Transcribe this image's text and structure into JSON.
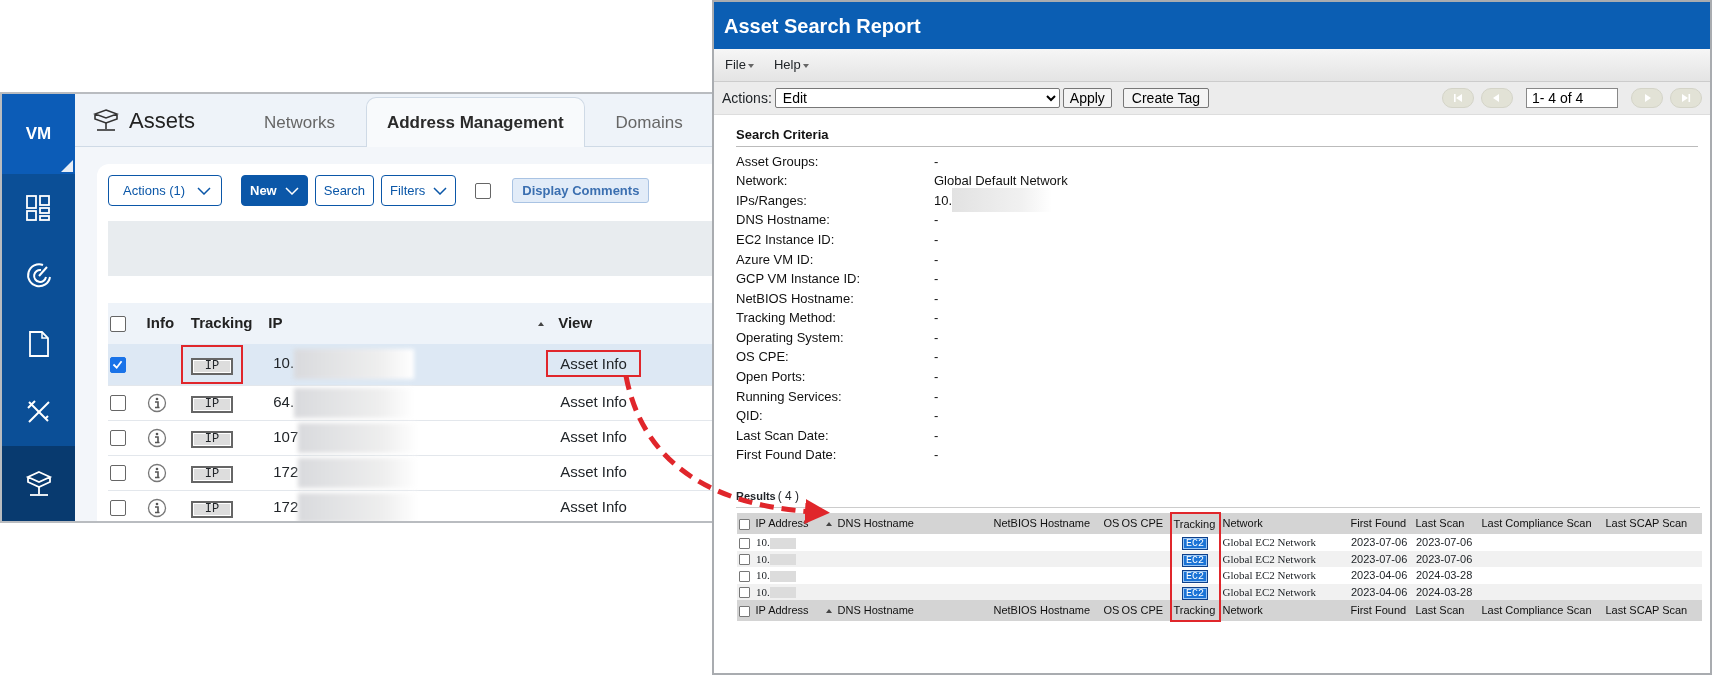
{
  "assets_app": {
    "logo": "VM",
    "sidebar": [
      {
        "kind": "dashboard",
        "selected": false
      },
      {
        "kind": "gauge",
        "selected": false
      },
      {
        "kind": "document",
        "selected": false
      },
      {
        "kind": "tools",
        "selected": false
      },
      {
        "kind": "assets",
        "selected": true
      }
    ],
    "title": "Assets",
    "tabs": [
      {
        "label": "Networks",
        "selected": false
      },
      {
        "label": "Address Management",
        "selected": true
      },
      {
        "label": "Domains",
        "selected": false
      }
    ],
    "toolbar": {
      "actions": "Actions (1)",
      "new": "New",
      "search": "Search",
      "filters": "Filters",
      "display_comments": {
        "label": "Display Comments",
        "checked": false
      }
    },
    "table": {
      "header_checked": false,
      "columns": [
        {
          "label": "Info",
          "sorted": false
        },
        {
          "label": "Tracking",
          "sorted": false
        },
        {
          "label": "IP",
          "sorted": false
        },
        {
          "label": "View",
          "sorted": true
        }
      ],
      "rows": [
        {
          "checked": true,
          "selected": true,
          "highlighted": true,
          "info_icon": false,
          "tracking": "IP",
          "ip": "10.",
          "view": "Asset Info"
        },
        {
          "checked": false,
          "selected": false,
          "highlighted": false,
          "info_icon": true,
          "tracking": "IP",
          "ip": "64.",
          "view": "Asset Info"
        },
        {
          "checked": false,
          "selected": false,
          "highlighted": false,
          "info_icon": true,
          "tracking": "IP",
          "ip": "107",
          "view": "Asset Info"
        },
        {
          "checked": false,
          "selected": false,
          "highlighted": false,
          "info_icon": true,
          "tracking": "IP",
          "ip": "172",
          "view": "Asset Info"
        },
        {
          "checked": false,
          "selected": false,
          "highlighted": false,
          "info_icon": true,
          "tracking": "IP",
          "ip": "172",
          "view": "Asset Info"
        }
      ]
    }
  },
  "report_window": {
    "title": "Asset Search Report",
    "menu": [
      "File",
      "Help"
    ],
    "actions": {
      "label": "Actions:",
      "select": "Edit",
      "apply": "Apply",
      "create_tag": "Create Tag",
      "pager": "1- 4 of 4"
    },
    "criteria": {
      "heading": "Search Criteria",
      "items": [
        {
          "label": "Asset Groups:",
          "value": "-"
        },
        {
          "label": "Network:",
          "value": "Global Default Network"
        },
        {
          "label": "IPs/Ranges:",
          "value": "10.",
          "blurred": true
        },
        {
          "label": "DNS Hostname:",
          "value": "-"
        },
        {
          "label": "EC2 Instance ID:",
          "value": "-"
        },
        {
          "label": "Azure VM ID:",
          "value": "-"
        },
        {
          "label": "GCP VM Instance ID:",
          "value": "-"
        },
        {
          "label": "NetBIOS Hostname:",
          "value": "-"
        },
        {
          "label": "Tracking Method:",
          "value": "-"
        },
        {
          "label": "Operating System:",
          "value": "-"
        },
        {
          "label": "OS CPE:",
          "value": "-"
        },
        {
          "label": "Open Ports:",
          "value": "-"
        },
        {
          "label": "Running Services:",
          "value": "-"
        },
        {
          "label": "QID:",
          "value": "-"
        },
        {
          "label": "Last Scan Date:",
          "value": "-"
        },
        {
          "label": "First Found Date:",
          "value": "-"
        }
      ]
    },
    "results": {
      "label": "Results",
      "count": "( 4 )",
      "header_checked": false,
      "footer_checked": false,
      "columns": [
        {
          "label": "IP Address",
          "sorted": false,
          "highlighted": false
        },
        {
          "label": "DNS Hostname",
          "sorted": true,
          "highlighted": false
        },
        {
          "label": "NetBIOS Hostname",
          "sorted": false,
          "highlighted": false
        },
        {
          "label": "OS",
          "sorted": false,
          "highlighted": false
        },
        {
          "label": "OS CPE",
          "sorted": false,
          "highlighted": false
        },
        {
          "label": "Tracking",
          "sorted": false,
          "highlighted": true
        },
        {
          "label": "Network",
          "sorted": false,
          "highlighted": false
        },
        {
          "label": "First Found",
          "sorted": false,
          "highlighted": false
        },
        {
          "label": "Last Scan",
          "sorted": false,
          "highlighted": false
        },
        {
          "label": "Last Compliance Scan",
          "sorted": false,
          "highlighted": false
        },
        {
          "label": "Last SCAP Scan",
          "sorted": false,
          "highlighted": false
        }
      ],
      "rows": [
        {
          "checked": false,
          "ip": "10.",
          "tracking": "EC2",
          "network": "Global EC2 Network",
          "first_found": "2023-07-06",
          "last_scan": "2023-07-06"
        },
        {
          "checked": false,
          "ip": "10.",
          "tracking": "EC2",
          "network": "Global EC2 Network",
          "first_found": "2023-07-06",
          "last_scan": "2023-07-06"
        },
        {
          "checked": false,
          "ip": "10.",
          "tracking": "EC2",
          "network": "Global EC2 Network",
          "first_found": "2023-04-06",
          "last_scan": "2024-03-28"
        },
        {
          "checked": false,
          "ip": "10.",
          "tracking": "EC2",
          "network": "Global EC2 Network",
          "first_found": "2023-04-06",
          "last_scan": "2024-03-28"
        }
      ],
      "footer_columns": [
        {
          "label": "IP Address",
          "sorted": false,
          "highlighted": false
        },
        {
          "label": "DNS Hostname",
          "sorted": true,
          "highlighted": false
        },
        {
          "label": "NetBIOS Hostname",
          "sorted": false,
          "highlighted": false
        },
        {
          "label": "OS",
          "sorted": false,
          "highlighted": false
        },
        {
          "label": "OS CPE",
          "sorted": false,
          "highlighted": false
        },
        {
          "label": "Tracking",
          "sorted": false,
          "highlighted": true
        },
        {
          "label": "Network",
          "sorted": false,
          "highlighted": false
        },
        {
          "label": "First Found",
          "sorted": false,
          "highlighted": false
        },
        {
          "label": "Last Scan",
          "sorted": false,
          "highlighted": false
        },
        {
          "label": "Last Compliance Scan",
          "sorted": false,
          "highlighted": false
        },
        {
          "label": "Last SCAP Scan",
          "sorted": false,
          "highlighted": false
        }
      ]
    }
  },
  "callout": {
    "arrow": true
  }
}
